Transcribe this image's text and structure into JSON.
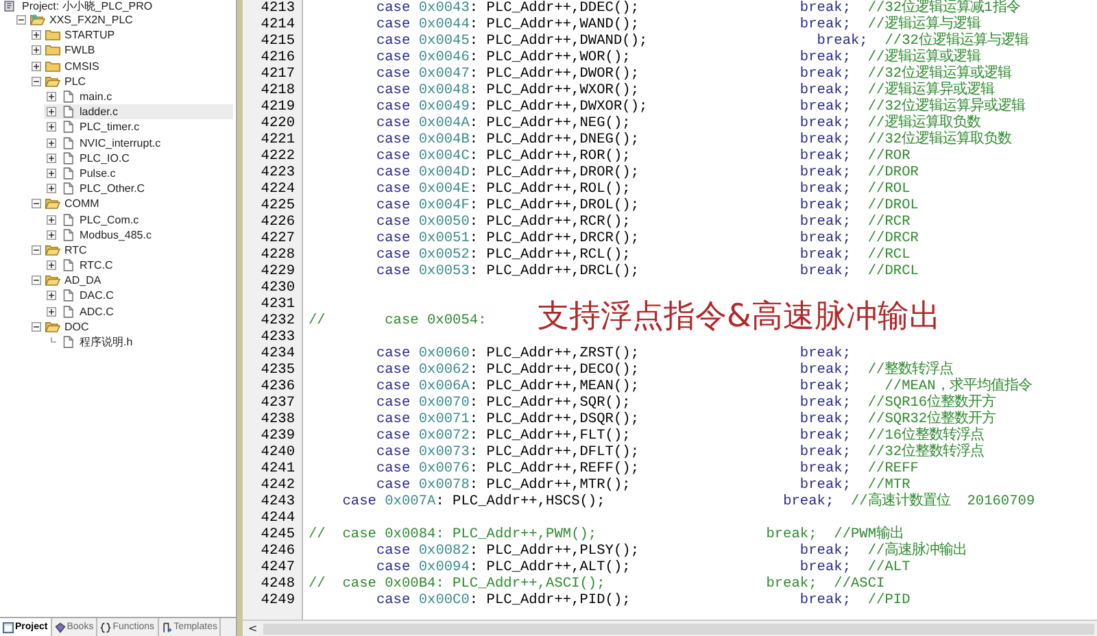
{
  "project": {
    "title": "Project: 小小晓_PLC_PRO",
    "tree": [
      {
        "label": "XXS_FX2N_PLC",
        "kind": "target",
        "expanded": true,
        "selected": false,
        "children": [
          {
            "label": "STARTUP",
            "kind": "folder",
            "expanded": false,
            "selected": false
          },
          {
            "label": "FWLB",
            "kind": "folder",
            "expanded": false,
            "selected": false
          },
          {
            "label": "CMSIS",
            "kind": "folder",
            "expanded": false,
            "selected": false
          },
          {
            "label": "PLC",
            "kind": "folder",
            "expanded": true,
            "selected": false,
            "children": [
              {
                "label": "main.c",
                "kind": "file",
                "expanded": false,
                "selected": false
              },
              {
                "label": "ladder.c",
                "kind": "file",
                "expanded": false,
                "selected": true
              },
              {
                "label": "PLC_timer.c",
                "kind": "file",
                "expanded": false,
                "selected": false
              },
              {
                "label": "NVIC_interrupt.c",
                "kind": "file",
                "expanded": false,
                "selected": false
              },
              {
                "label": "PLC_IO.C",
                "kind": "file",
                "expanded": false,
                "selected": false
              },
              {
                "label": "Pulse.c",
                "kind": "file",
                "expanded": false,
                "selected": false
              },
              {
                "label": "PLC_Other.C",
                "kind": "file",
                "expanded": false,
                "selected": false
              }
            ]
          },
          {
            "label": "COMM",
            "kind": "folder",
            "expanded": true,
            "selected": false,
            "children": [
              {
                "label": "PLC_Com.c",
                "kind": "file",
                "expanded": false,
                "selected": false
              },
              {
                "label": "Modbus_485.c",
                "kind": "file",
                "expanded": false,
                "selected": false
              }
            ]
          },
          {
            "label": "RTC",
            "kind": "folder",
            "expanded": true,
            "selected": false,
            "children": [
              {
                "label": "RTC.C",
                "kind": "file",
                "expanded": false,
                "selected": false
              }
            ]
          },
          {
            "label": "AD_DA",
            "kind": "folder",
            "expanded": true,
            "selected": false,
            "children": [
              {
                "label": "DAC.C",
                "kind": "file",
                "expanded": false,
                "selected": false
              },
              {
                "label": "ADC.C",
                "kind": "file",
                "expanded": false,
                "selected": false
              }
            ]
          },
          {
            "label": "DOC",
            "kind": "folder",
            "expanded": true,
            "selected": false,
            "children": [
              {
                "label": "程序说明.h",
                "kind": "leaf",
                "selected": false
              }
            ]
          }
        ]
      }
    ],
    "tabs": [
      {
        "label": "Project",
        "kind": "project",
        "selected": true
      },
      {
        "label": "Books",
        "kind": "books",
        "selected": false
      },
      {
        "label": "Functions",
        "kind": "functions",
        "selected": false
      },
      {
        "label": "Templates",
        "kind": "templates",
        "selected": false
      }
    ]
  },
  "editor": {
    "lines": [
      {
        "number": "4213",
        "kind": "case",
        "keyword": "case",
        "hex": "0x0043",
        "call": ": PLC_Addr++,DDEC();",
        "brk": "break;",
        "comment": "//32位逻辑运算减1指令"
      },
      {
        "number": "4214",
        "kind": "case",
        "keyword": "case",
        "hex": "0x0044",
        "call": ": PLC_Addr++,WAND();",
        "brk": "break;",
        "comment": "//逻辑运算与逻辑"
      },
      {
        "number": "4215",
        "kind": "case_wide",
        "keyword": "case",
        "hex": "0x0045",
        "call": ": PLC_Addr++,DWAND();",
        "brk": "break;",
        "comment": "//32位逻辑运算与逻辑"
      },
      {
        "number": "4216",
        "kind": "case",
        "keyword": "case",
        "hex": "0x0046",
        "call": ": PLC_Addr++,WOR();",
        "brk": "break;",
        "comment": "//逻辑运算或逻辑"
      },
      {
        "number": "4217",
        "kind": "case",
        "keyword": "case",
        "hex": "0x0047",
        "call": ": PLC_Addr++,DWOR();",
        "brk": "break;",
        "comment": "//32位逻辑运算或逻辑"
      },
      {
        "number": "4218",
        "kind": "case",
        "keyword": "case",
        "hex": "0x0048",
        "call": ": PLC_Addr++,WXOR();",
        "brk": "break;",
        "comment": "//逻辑运算异或逻辑"
      },
      {
        "number": "4219",
        "kind": "case",
        "keyword": "case",
        "hex": "0x0049",
        "call": ": PLC_Addr++,DWXOR();",
        "brk": "break;",
        "comment": "//32位逻辑运算异或逻辑"
      },
      {
        "number": "4220",
        "kind": "case",
        "keyword": "case",
        "hex": "0x004A",
        "call": ": PLC_Addr++,NEG();",
        "brk": "break;",
        "comment": "//逻辑运算取负数"
      },
      {
        "number": "4221",
        "kind": "case",
        "keyword": "case",
        "hex": "0x004B",
        "call": ": PLC_Addr++,DNEG();",
        "brk": "break;",
        "comment": "//32位逻辑运算取负数"
      },
      {
        "number": "4222",
        "kind": "case",
        "keyword": "case",
        "hex": "0x004C",
        "call": ": PLC_Addr++,ROR();",
        "brk": "break;",
        "comment": "//ROR"
      },
      {
        "number": "4223",
        "kind": "case",
        "keyword": "case",
        "hex": "0x004D",
        "call": ": PLC_Addr++,DROR();",
        "brk": "break;",
        "comment": "//DROR"
      },
      {
        "number": "4224",
        "kind": "case",
        "keyword": "case",
        "hex": "0x004E",
        "call": ": PLC_Addr++,ROL();",
        "brk": "break;",
        "comment": "//ROL"
      },
      {
        "number": "4225",
        "kind": "case",
        "keyword": "case",
        "hex": "0x004F",
        "call": ": PLC_Addr++,DROL();",
        "brk": "break;",
        "comment": "//DROL"
      },
      {
        "number": "4226",
        "kind": "case",
        "keyword": "case",
        "hex": "0x0050",
        "call": ": PLC_Addr++,RCR();",
        "brk": "break;",
        "comment": "//RCR"
      },
      {
        "number": "4227",
        "kind": "case",
        "keyword": "case",
        "hex": "0x0051",
        "call": ": PLC_Addr++,DRCR();",
        "brk": "break;",
        "comment": "//DRCR"
      },
      {
        "number": "4228",
        "kind": "case",
        "keyword": "case",
        "hex": "0x0052",
        "call": ": PLC_Addr++,RCL();",
        "brk": "break;",
        "comment": "//RCL"
      },
      {
        "number": "4229",
        "kind": "case",
        "keyword": "case",
        "hex": "0x0053",
        "call": ": PLC_Addr++,DRCL();",
        "brk": "break;",
        "comment": "//DRCL"
      },
      {
        "number": "4230",
        "kind": "blank"
      },
      {
        "number": "4231",
        "kind": "blank"
      },
      {
        "number": "4232",
        "kind": "commented",
        "text": "//       case 0x0054:"
      },
      {
        "number": "4233",
        "kind": "blank"
      },
      {
        "number": "4234",
        "kind": "case",
        "keyword": "case",
        "hex": "0x0060",
        "call": ": PLC_Addr++,ZRST();",
        "brk": "break;"
      },
      {
        "number": "4235",
        "kind": "case",
        "keyword": "case",
        "hex": "0x0062",
        "call": ": PLC_Addr++,DECO();",
        "brk": "break;",
        "comment": "//整数转浮点"
      },
      {
        "number": "4236",
        "kind": "case",
        "keyword": "case",
        "hex": "0x006A",
        "call": ": PLC_Addr++,MEAN();",
        "brk": "break;",
        "comment": "  //MEAN，求平均值指令"
      },
      {
        "number": "4237",
        "kind": "case",
        "keyword": "case",
        "hex": "0x0070",
        "call": ": PLC_Addr++,SQR();",
        "brk": "break;",
        "comment": "//SQR16位整数开方"
      },
      {
        "number": "4238",
        "kind": "case",
        "keyword": "case",
        "hex": "0x0071",
        "call": ": PLC_Addr++,DSQR();",
        "brk": "break;",
        "comment": "//SQR32位整数开方"
      },
      {
        "number": "4239",
        "kind": "case",
        "keyword": "case",
        "hex": "0x0072",
        "call": ": PLC_Addr++,FLT();",
        "brk": "break;",
        "comment": "//16位整数转浮点"
      },
      {
        "number": "4240",
        "kind": "case",
        "keyword": "case",
        "hex": "0x0073",
        "call": ": PLC_Addr++,DFLT();",
        "brk": "break;",
        "comment": "//32位整数转浮点"
      },
      {
        "number": "4241",
        "kind": "case",
        "keyword": "case",
        "hex": "0x0076",
        "call": ": PLC_Addr++,REFF();",
        "brk": "break;",
        "comment": "//REFF"
      },
      {
        "number": "4242",
        "kind": "case",
        "keyword": "case",
        "hex": "0x0078",
        "call": ": PLC_Addr++,MTR();",
        "brk": "break;",
        "comment": "//MTR"
      },
      {
        "number": "4243",
        "kind": "case_outdent",
        "keyword": "case",
        "hex": "0x007A",
        "call": ": PLC_Addr++,HSCS();",
        "brk": "break;",
        "comment": "//高速计数置位  20160709"
      },
      {
        "number": "4244",
        "kind": "blank"
      },
      {
        "number": "4245",
        "kind": "commented_case",
        "prefix": "//",
        "keyword": "case",
        "hex": "0x0084",
        "call": ": PLC_Addr++,PWM();",
        "brk": "break;",
        "comment": "//PWM输出"
      },
      {
        "number": "4246",
        "kind": "case",
        "keyword": "case",
        "hex": "0x0082",
        "call": ": PLC_Addr++,PLSY();",
        "brk": "break;",
        "comment": "//高速脉冲输出"
      },
      {
        "number": "4247",
        "kind": "case",
        "keyword": "case",
        "hex": "0x0094",
        "call": ": PLC_Addr++,ALT();",
        "brk": "break;",
        "comment": "//ALT"
      },
      {
        "number": "4248",
        "kind": "commented_case",
        "prefix": "//",
        "keyword": "case",
        "hex": "0x00B4",
        "call": ": PLC_Addr++,ASCI();",
        "brk": "break;",
        "comment": "//ASCI"
      },
      {
        "number": "4249",
        "kind": "case",
        "keyword": "case",
        "hex": "0x00C0",
        "call": ": PLC_Addr++,PID();",
        "brk": "break;",
        "comment": "//PID"
      }
    ],
    "scroll_left": "<",
    "overlay": "支持浮点指令&高速脉冲输出"
  }
}
